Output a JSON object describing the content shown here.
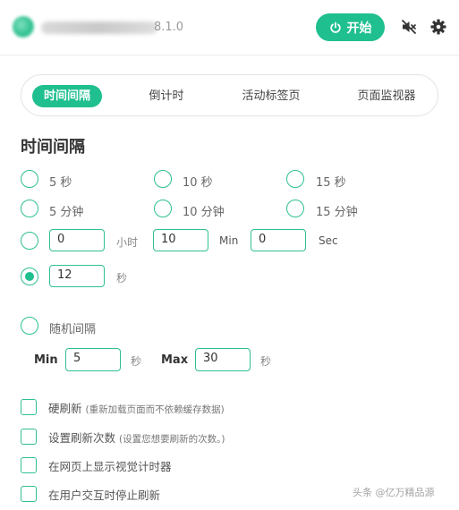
{
  "header": {
    "version": "8.1.0",
    "start_label": "开始",
    "mute_icon": "speaker-muted-icon",
    "settings_icon": "gear-icon",
    "accent": "#1fbf8f"
  },
  "tabs": [
    {
      "label": "时间间隔",
      "active": true
    },
    {
      "label": "倒计时",
      "active": false
    },
    {
      "label": "活动标签页",
      "active": false
    },
    {
      "label": "页面监视器",
      "active": false
    }
  ],
  "section_title": "时间间隔",
  "presets": [
    {
      "label": "5 秒"
    },
    {
      "label": "10 秒"
    },
    {
      "label": "15 秒"
    },
    {
      "label": "5 分钟"
    },
    {
      "label": "10 分钟"
    },
    {
      "label": "15 分钟"
    }
  ],
  "custom_hms": {
    "hours": "0",
    "hours_unit": "小时",
    "minutes": "10",
    "minutes_unit": "Min",
    "seconds": "0",
    "seconds_unit": "Sec"
  },
  "custom_seconds": {
    "value": "12",
    "unit": "秒",
    "selected": true
  },
  "random": {
    "label": "随机间隔",
    "min_label": "Min",
    "min_value": "5",
    "min_unit": "秒",
    "max_label": "Max",
    "max_value": "30",
    "max_unit": "秒"
  },
  "options": [
    {
      "label": "硬刷新",
      "hint": "(重新加载页面而不依赖缓存数据)"
    },
    {
      "label": "设置刷新次数",
      "hint": "(设置您想要刷新的次数。)"
    },
    {
      "label": "在网页上显示视觉计时器",
      "hint": ""
    },
    {
      "label": "在用户交互时停止刷新",
      "hint": ""
    }
  ],
  "watermark": "头条 @亿万精品源"
}
